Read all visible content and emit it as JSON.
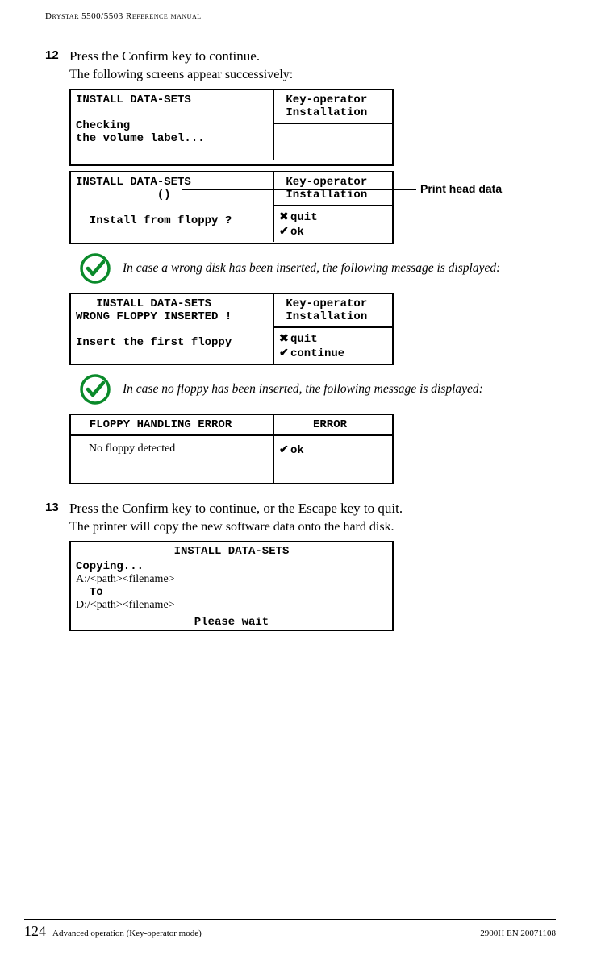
{
  "running_head": "Drystar 5500/5503 Reference manual",
  "step12": {
    "num": "12",
    "title": "Press the Confirm key to continue.",
    "sub": "The following screens appear successively:"
  },
  "screen1": {
    "left": "INSTALL DATA-SETS\n\nChecking\nthe volume label...",
    "rightTop": " Key-operator\n Installation",
    "rightBot": ""
  },
  "screen2": {
    "left": "INSTALL DATA-SETS\n            ()\n\n  Install from floppy ?",
    "rightTop": " Key-operator\n Installation",
    "rightBot_l1": "quit",
    "rightBot_l2": "ok"
  },
  "callout": "Print head data",
  "note1": "In case a wrong disk has been inserted, the following message is displayed:",
  "screen3": {
    "left": "   INSTALL DATA-SETS\nWRONG FLOPPY INSERTED !\n\nInsert the first floppy",
    "rightTop": " Key-operator\n Installation",
    "rightBot_l1": "quit",
    "rightBot_l2": "continue"
  },
  "note2": "In case no floppy has been inserted, the following message is displayed:",
  "screen4": {
    "leftTop": "  FLOPPY HANDLING ERROR",
    "leftBot_overlay": "No floppy detected",
    "rightTop": "     ERROR",
    "rightBot": "ok"
  },
  "step13": {
    "num": "13",
    "title": "Press the Confirm key to continue, or the Escape key to quit.",
    "sub": "The printer will copy the new software data onto the hard disk."
  },
  "screen5": {
    "title": "INSTALL DATA-SETS",
    "l1": "Copying...",
    "l2": "A:/<path><filename>",
    "l3": "  To",
    "l4": "D:/<path><filename>",
    "l5": "Please wait"
  },
  "footer": {
    "page": "124",
    "left": "Advanced operation (Key-operator mode)",
    "right": "2900H EN 20071108"
  }
}
